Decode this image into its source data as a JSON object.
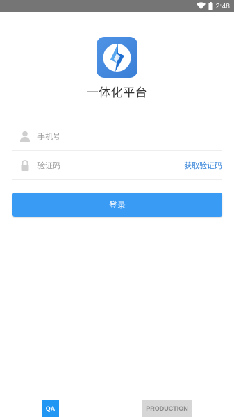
{
  "status_bar": {
    "time": "2:48",
    "icons": [
      "wifi-icon",
      "battery-icon"
    ]
  },
  "app": {
    "logo_icon": "app-logo-icon",
    "title": "一体化平台"
  },
  "form": {
    "phone": {
      "icon": "user-icon",
      "value": "",
      "placeholder": "手机号"
    },
    "code": {
      "icon": "lock-icon",
      "value": "",
      "placeholder": "验证码",
      "get_code_label": "获取验证码"
    },
    "login_label": "登录"
  },
  "environments": {
    "qa_label": "QA",
    "production_label": "PRODUCTION"
  },
  "colors": {
    "primary": "#3a9bf5",
    "link": "#2f7fd8",
    "status_bar": "#757575",
    "qa_active": "#2196f3",
    "production_inactive": "#d6d6d6"
  }
}
